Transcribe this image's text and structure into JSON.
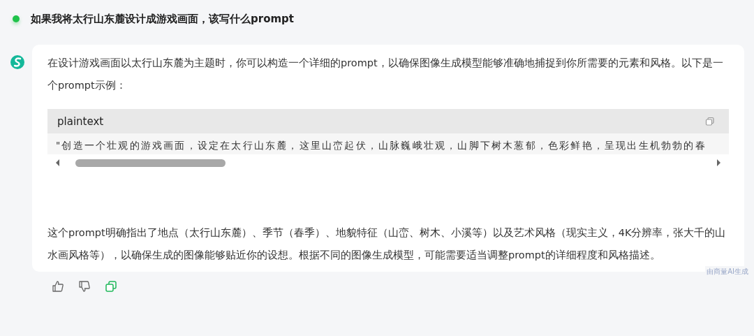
{
  "question": {
    "text": "如果我将太行山东麓设计成游戏画面，该写什么prompt"
  },
  "answer": {
    "intro": "在设计游戏画面以太行山东麓为主题时，你可以构造一个详细的prompt，以确保图像生成模型能够准确地捕捉到你所需要的元素和风格。以下是一个prompt示例：",
    "code_block": {
      "language": "plaintext",
      "code": "\"创造一个壮观的游戏画面，设定在太行山东麓，这里山峦起伏，山脉巍峨壮观，山脚下树木葱郁，色彩鲜艳，呈现出生机勃勃的春"
    },
    "conclusion": "这个prompt明确指出了地点（太行山东麓）、季节（春季）、地貌特征（山峦、树木、小溪等）以及艺术风格（现实主义，4K分辨率，张大千的山水画风格等），以确保生成的图像能够贴近你的设想。根据不同的图像生成模型，可能需要适当调整prompt的详细程度和风格描述。",
    "ai_label": "由商量AI生成"
  }
}
